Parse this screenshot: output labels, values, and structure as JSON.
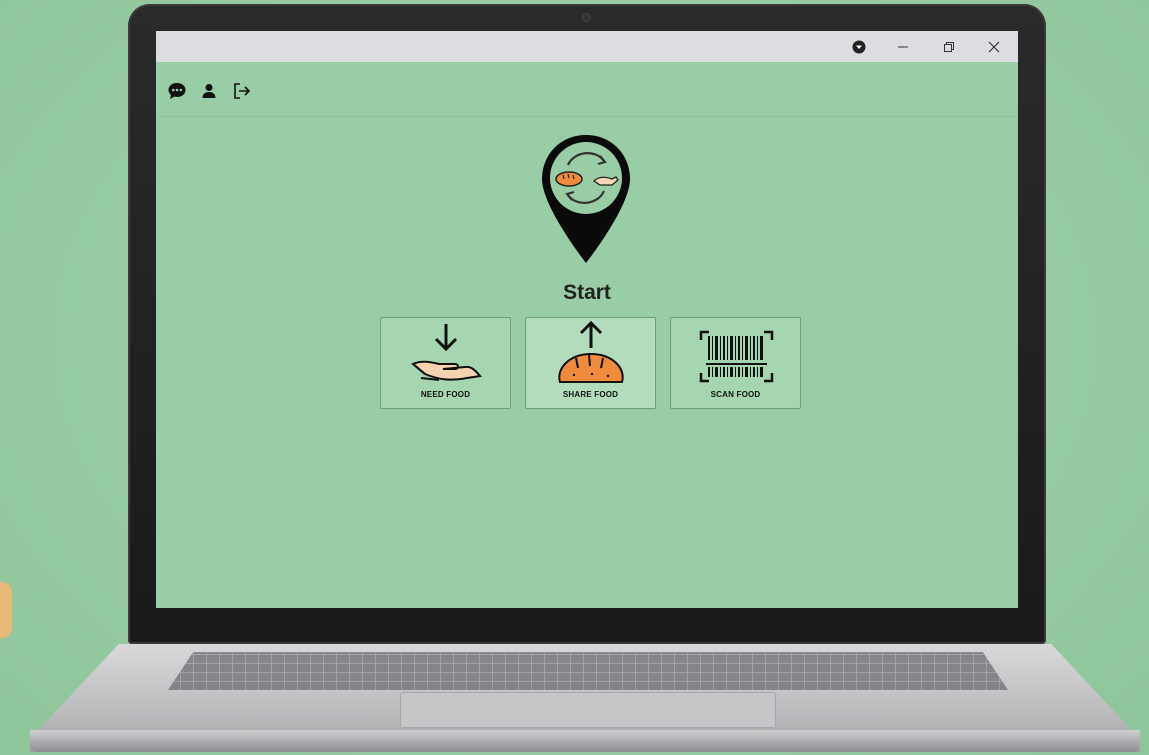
{
  "window_controls": {
    "account_menu_icon": "chevron-circle-icon",
    "minimize_icon": "minimize-icon",
    "restore_icon": "restore-icon",
    "close_icon": "close-icon"
  },
  "toolbar": {
    "icons": [
      "chat-icon",
      "user-icon",
      "logout-icon"
    ]
  },
  "main": {
    "title": "Start",
    "actions": [
      {
        "label": "NEED FOOD",
        "icon": "receive-hand-icon"
      },
      {
        "label": "SHARE FOOD",
        "icon": "share-bread-icon"
      },
      {
        "label": "SCAN FOOD",
        "icon": "barcode-scan-icon"
      }
    ]
  },
  "colors": {
    "background": "#99cda5",
    "titlebar": "#dcdde1",
    "accent_orange": "#f08a3c",
    "text_dark": "#222222"
  }
}
